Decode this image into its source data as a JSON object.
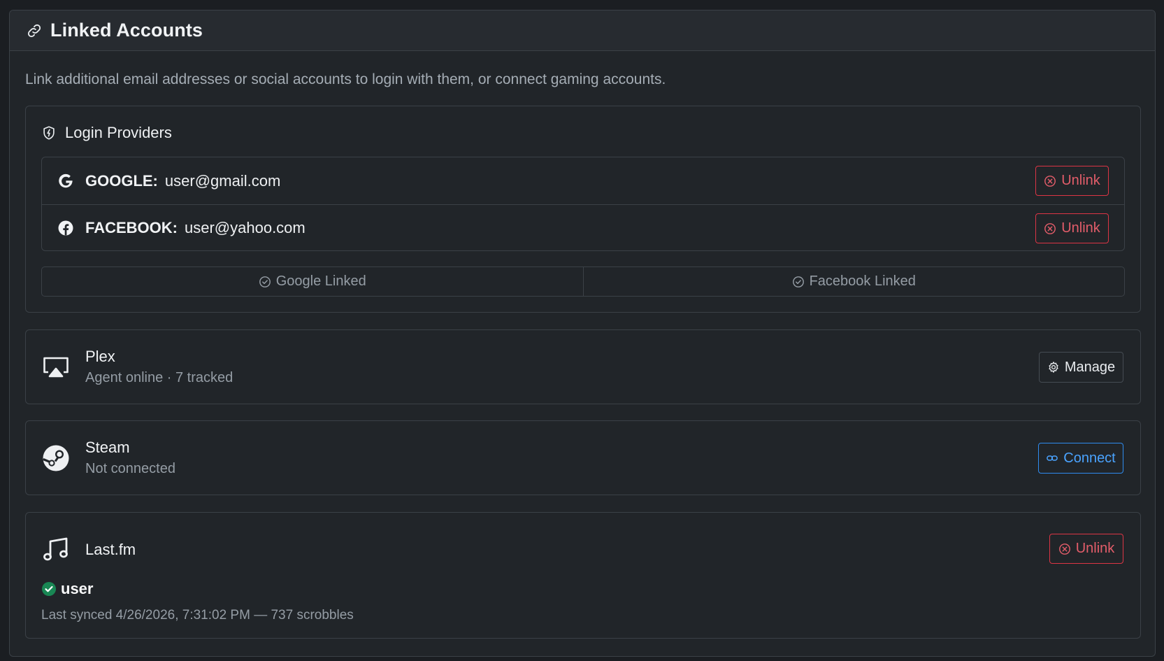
{
  "header": {
    "title": "Linked Accounts",
    "icon": "link-icon"
  },
  "description": "Link additional email addresses or social accounts to login with them, or connect gaming accounts.",
  "login_providers": {
    "title": "Login Providers",
    "icon": "shield-icon",
    "providers": [
      {
        "name": "GOOGLE:",
        "value": "user@gmail.com",
        "icon": "google-icon",
        "action": "Unlink"
      },
      {
        "name": "FACEBOOK:",
        "value": "user@yahoo.com",
        "icon": "facebook-icon",
        "action": "Unlink"
      }
    ],
    "linked_status": [
      "Google Linked",
      "Facebook Linked"
    ]
  },
  "services": {
    "plex": {
      "name": "Plex",
      "status": "Agent online · 7 tracked",
      "action": "Manage",
      "icon": "airplay-icon"
    },
    "steam": {
      "name": "Steam",
      "status": "Not connected",
      "action": "Connect",
      "icon": "steam-icon"
    },
    "lastfm": {
      "name": "Last.fm",
      "action": "Unlink",
      "icon": "music-note-icon",
      "username": "user",
      "synced": "Last synced 4/26/2026, 7:31:02 PM — 737 scrobbles"
    }
  },
  "colors": {
    "background": "#1b1e22",
    "card": "#212529",
    "border": "#3b4147",
    "danger": "#dc3545",
    "primary": "#2f8cf0",
    "success": "#198754"
  }
}
